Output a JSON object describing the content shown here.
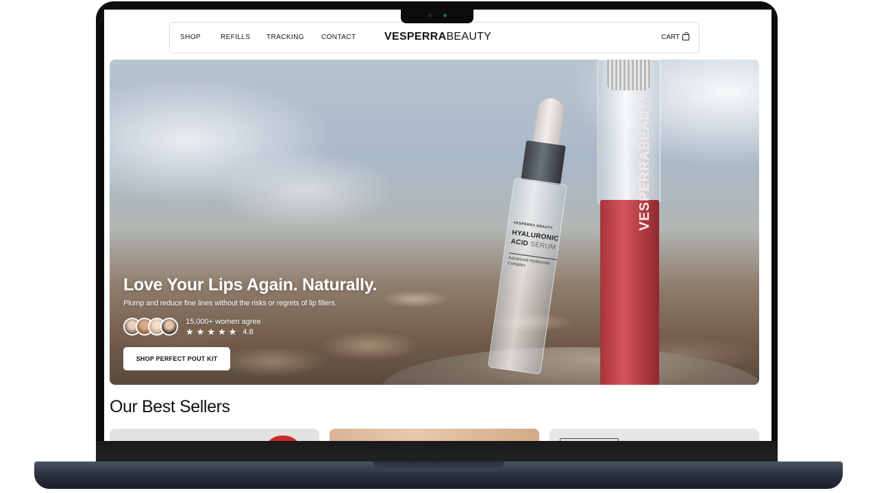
{
  "nav": {
    "links": [
      "SHOP",
      "REFILLS",
      "TRACKING",
      "CONTACT"
    ],
    "brand_bold": "VESPERRA",
    "brand_light": "BEAUTY",
    "cart_label": "CART"
  },
  "hero": {
    "title": "Love Your Lips Again. Naturally.",
    "subtitle": "Plump and reduce fine lines without the risks or regrets of lip fillers.",
    "social_proof": "15,000+ women agree",
    "rating_value": "4.8",
    "rating_stars": 5,
    "cta_label": "SHOP PERFECT POUT KIT",
    "bottle_label": {
      "brand": "VESPERRA BEAUTY",
      "line1": "HYALURONIC",
      "line2_bold": "ACID",
      "line2_light": "SERUM",
      "sub": "Advanced Hyaluronic Complex"
    },
    "tube_label": {
      "bold": "VESPERRA",
      "light": "BEAUTY"
    }
  },
  "best_sellers": {
    "title": "Our Best Sellers"
  },
  "colors": {
    "tube_red": "#c8464c",
    "cta_bg": "#ffffff",
    "frame": "#0d0d0f"
  }
}
